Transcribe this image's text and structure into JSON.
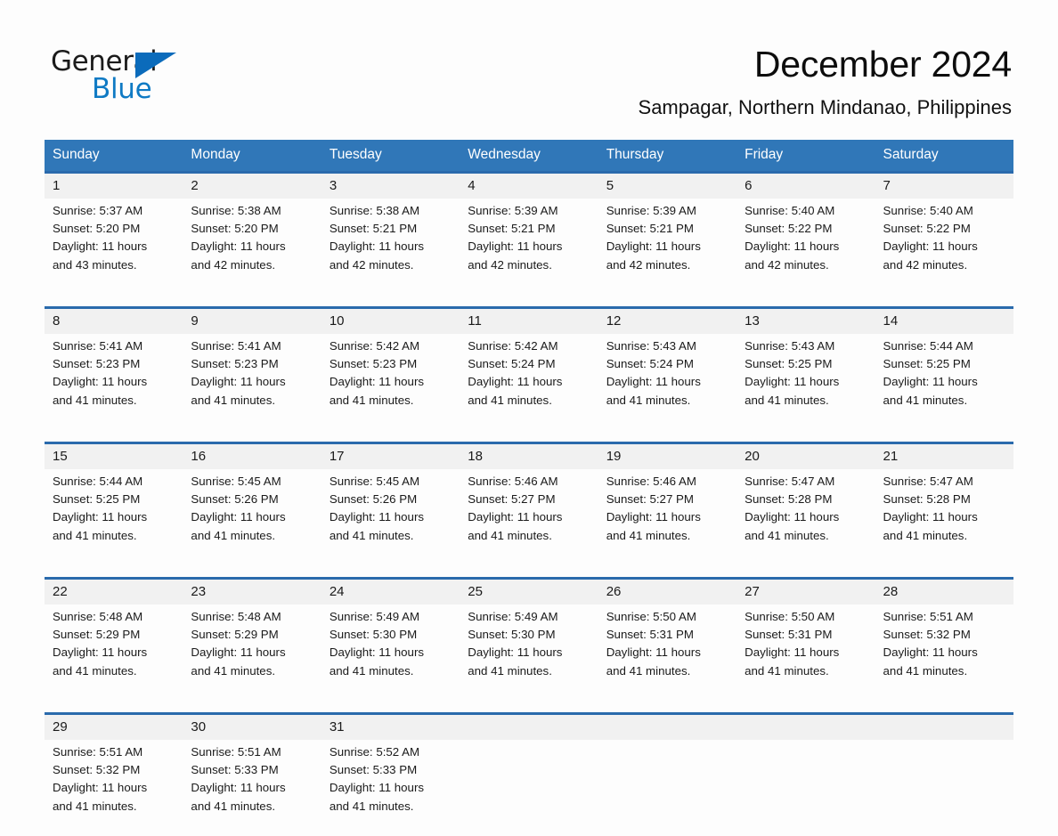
{
  "logo": {
    "word_one": "General",
    "word_two": "Blue",
    "triangle_color": "#0b6bbb",
    "blue_color": "#0f7ac4"
  },
  "header": {
    "month_title": "December 2024",
    "location": "Sampagar, Northern Mindanao, Philippines"
  },
  "theme": {
    "header_blue": "#3077b8",
    "row_border_blue": "#2a6aac",
    "daynum_background": "#f1f1f1",
    "page_background": "#fdfdfd"
  },
  "calendar": {
    "weekday_headers": [
      "Sunday",
      "Monday",
      "Tuesday",
      "Wednesday",
      "Thursday",
      "Friday",
      "Saturday"
    ],
    "weeks": [
      {
        "days": [
          {
            "date": "1",
            "sunrise": "Sunrise: 5:37 AM",
            "sunset": "Sunset: 5:20 PM",
            "daylight_1": "Daylight: 11 hours",
            "daylight_2": "and 43 minutes."
          },
          {
            "date": "2",
            "sunrise": "Sunrise: 5:38 AM",
            "sunset": "Sunset: 5:20 PM",
            "daylight_1": "Daylight: 11 hours",
            "daylight_2": "and 42 minutes."
          },
          {
            "date": "3",
            "sunrise": "Sunrise: 5:38 AM",
            "sunset": "Sunset: 5:21 PM",
            "daylight_1": "Daylight: 11 hours",
            "daylight_2": "and 42 minutes."
          },
          {
            "date": "4",
            "sunrise": "Sunrise: 5:39 AM",
            "sunset": "Sunset: 5:21 PM",
            "daylight_1": "Daylight: 11 hours",
            "daylight_2": "and 42 minutes."
          },
          {
            "date": "5",
            "sunrise": "Sunrise: 5:39 AM",
            "sunset": "Sunset: 5:21 PM",
            "daylight_1": "Daylight: 11 hours",
            "daylight_2": "and 42 minutes."
          },
          {
            "date": "6",
            "sunrise": "Sunrise: 5:40 AM",
            "sunset": "Sunset: 5:22 PM",
            "daylight_1": "Daylight: 11 hours",
            "daylight_2": "and 42 minutes."
          },
          {
            "date": "7",
            "sunrise": "Sunrise: 5:40 AM",
            "sunset": "Sunset: 5:22 PM",
            "daylight_1": "Daylight: 11 hours",
            "daylight_2": "and 42 minutes."
          }
        ]
      },
      {
        "days": [
          {
            "date": "8",
            "sunrise": "Sunrise: 5:41 AM",
            "sunset": "Sunset: 5:23 PM",
            "daylight_1": "Daylight: 11 hours",
            "daylight_2": "and 41 minutes."
          },
          {
            "date": "9",
            "sunrise": "Sunrise: 5:41 AM",
            "sunset": "Sunset: 5:23 PM",
            "daylight_1": "Daylight: 11 hours",
            "daylight_2": "and 41 minutes."
          },
          {
            "date": "10",
            "sunrise": "Sunrise: 5:42 AM",
            "sunset": "Sunset: 5:23 PM",
            "daylight_1": "Daylight: 11 hours",
            "daylight_2": "and 41 minutes."
          },
          {
            "date": "11",
            "sunrise": "Sunrise: 5:42 AM",
            "sunset": "Sunset: 5:24 PM",
            "daylight_1": "Daylight: 11 hours",
            "daylight_2": "and 41 minutes."
          },
          {
            "date": "12",
            "sunrise": "Sunrise: 5:43 AM",
            "sunset": "Sunset: 5:24 PM",
            "daylight_1": "Daylight: 11 hours",
            "daylight_2": "and 41 minutes."
          },
          {
            "date": "13",
            "sunrise": "Sunrise: 5:43 AM",
            "sunset": "Sunset: 5:25 PM",
            "daylight_1": "Daylight: 11 hours",
            "daylight_2": "and 41 minutes."
          },
          {
            "date": "14",
            "sunrise": "Sunrise: 5:44 AM",
            "sunset": "Sunset: 5:25 PM",
            "daylight_1": "Daylight: 11 hours",
            "daylight_2": "and 41 minutes."
          }
        ]
      },
      {
        "days": [
          {
            "date": "15",
            "sunrise": "Sunrise: 5:44 AM",
            "sunset": "Sunset: 5:25 PM",
            "daylight_1": "Daylight: 11 hours",
            "daylight_2": "and 41 minutes."
          },
          {
            "date": "16",
            "sunrise": "Sunrise: 5:45 AM",
            "sunset": "Sunset: 5:26 PM",
            "daylight_1": "Daylight: 11 hours",
            "daylight_2": "and 41 minutes."
          },
          {
            "date": "17",
            "sunrise": "Sunrise: 5:45 AM",
            "sunset": "Sunset: 5:26 PM",
            "daylight_1": "Daylight: 11 hours",
            "daylight_2": "and 41 minutes."
          },
          {
            "date": "18",
            "sunrise": "Sunrise: 5:46 AM",
            "sunset": "Sunset: 5:27 PM",
            "daylight_1": "Daylight: 11 hours",
            "daylight_2": "and 41 minutes."
          },
          {
            "date": "19",
            "sunrise": "Sunrise: 5:46 AM",
            "sunset": "Sunset: 5:27 PM",
            "daylight_1": "Daylight: 11 hours",
            "daylight_2": "and 41 minutes."
          },
          {
            "date": "20",
            "sunrise": "Sunrise: 5:47 AM",
            "sunset": "Sunset: 5:28 PM",
            "daylight_1": "Daylight: 11 hours",
            "daylight_2": "and 41 minutes."
          },
          {
            "date": "21",
            "sunrise": "Sunrise: 5:47 AM",
            "sunset": "Sunset: 5:28 PM",
            "daylight_1": "Daylight: 11 hours",
            "daylight_2": "and 41 minutes."
          }
        ]
      },
      {
        "days": [
          {
            "date": "22",
            "sunrise": "Sunrise: 5:48 AM",
            "sunset": "Sunset: 5:29 PM",
            "daylight_1": "Daylight: 11 hours",
            "daylight_2": "and 41 minutes."
          },
          {
            "date": "23",
            "sunrise": "Sunrise: 5:48 AM",
            "sunset": "Sunset: 5:29 PM",
            "daylight_1": "Daylight: 11 hours",
            "daylight_2": "and 41 minutes."
          },
          {
            "date": "24",
            "sunrise": "Sunrise: 5:49 AM",
            "sunset": "Sunset: 5:30 PM",
            "daylight_1": "Daylight: 11 hours",
            "daylight_2": "and 41 minutes."
          },
          {
            "date": "25",
            "sunrise": "Sunrise: 5:49 AM",
            "sunset": "Sunset: 5:30 PM",
            "daylight_1": "Daylight: 11 hours",
            "daylight_2": "and 41 minutes."
          },
          {
            "date": "26",
            "sunrise": "Sunrise: 5:50 AM",
            "sunset": "Sunset: 5:31 PM",
            "daylight_1": "Daylight: 11 hours",
            "daylight_2": "and 41 minutes."
          },
          {
            "date": "27",
            "sunrise": "Sunrise: 5:50 AM",
            "sunset": "Sunset: 5:31 PM",
            "daylight_1": "Daylight: 11 hours",
            "daylight_2": "and 41 minutes."
          },
          {
            "date": "28",
            "sunrise": "Sunrise: 5:51 AM",
            "sunset": "Sunset: 5:32 PM",
            "daylight_1": "Daylight: 11 hours",
            "daylight_2": "and 41 minutes."
          }
        ]
      },
      {
        "days": [
          {
            "date": "29",
            "sunrise": "Sunrise: 5:51 AM",
            "sunset": "Sunset: 5:32 PM",
            "daylight_1": "Daylight: 11 hours",
            "daylight_2": "and 41 minutes."
          },
          {
            "date": "30",
            "sunrise": "Sunrise: 5:51 AM",
            "sunset": "Sunset: 5:33 PM",
            "daylight_1": "Daylight: 11 hours",
            "daylight_2": "and 41 minutes."
          },
          {
            "date": "31",
            "sunrise": "Sunrise: 5:52 AM",
            "sunset": "Sunset: 5:33 PM",
            "daylight_1": "Daylight: 11 hours",
            "daylight_2": "and 41 minutes."
          },
          {
            "date": "",
            "sunrise": "",
            "sunset": "",
            "daylight_1": "",
            "daylight_2": ""
          },
          {
            "date": "",
            "sunrise": "",
            "sunset": "",
            "daylight_1": "",
            "daylight_2": ""
          },
          {
            "date": "",
            "sunrise": "",
            "sunset": "",
            "daylight_1": "",
            "daylight_2": ""
          },
          {
            "date": "",
            "sunrise": "",
            "sunset": "",
            "daylight_1": "",
            "daylight_2": ""
          }
        ]
      }
    ]
  }
}
